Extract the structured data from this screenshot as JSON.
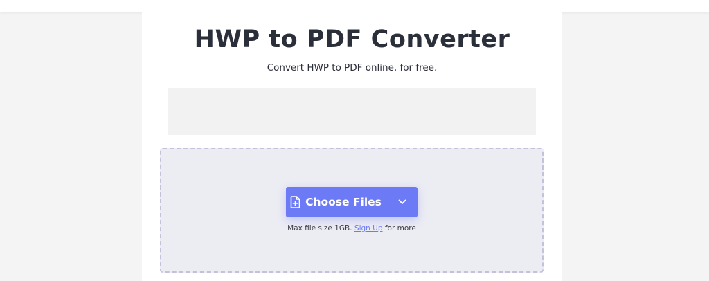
{
  "page": {
    "title": "HWP to PDF Converter",
    "subtitle": "Convert HWP to PDF online, for free."
  },
  "upload": {
    "choose_label": "Choose Files",
    "note_prefix": "Max file size 1GB.",
    "signup_link": "Sign Up",
    "note_suffix": "for more",
    "file_icon": "file-plus-icon",
    "dropdown_icon": "chevron-down-icon"
  },
  "colors": {
    "accent": "#6c7bf5",
    "title": "#2b2f3a",
    "dropzone_bg": "#ececf3",
    "dropzone_border": "#c5c1dc"
  }
}
